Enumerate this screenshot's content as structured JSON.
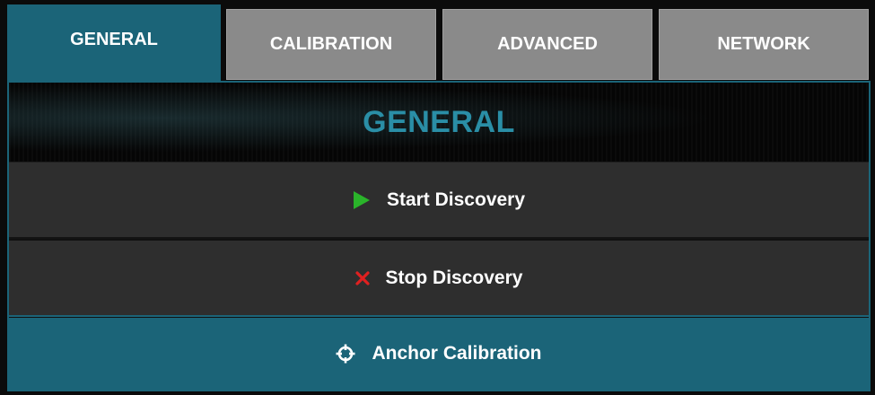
{
  "tabs": [
    {
      "label": "GENERAL",
      "active": true
    },
    {
      "label": "CALIBRATION",
      "active": false
    },
    {
      "label": "ADVANCED",
      "active": false
    },
    {
      "label": "NETWORK",
      "active": false
    }
  ],
  "panel": {
    "title": "GENERAL",
    "buttons": {
      "start": {
        "label": "Start Discovery",
        "icon": "play-icon",
        "icon_color": "#2ab42a"
      },
      "stop": {
        "label": "Stop Discovery",
        "icon": "close-icon",
        "icon_color": "#e02020"
      },
      "anchor": {
        "label": "Anchor Calibration",
        "icon": "crosshair-icon",
        "icon_color": "#ffffff"
      }
    }
  },
  "colors": {
    "accent": "#1b6478",
    "title": "#2a8ea6",
    "tab_inactive": "#8a8a8a",
    "button_bg": "#2e2e2e"
  }
}
